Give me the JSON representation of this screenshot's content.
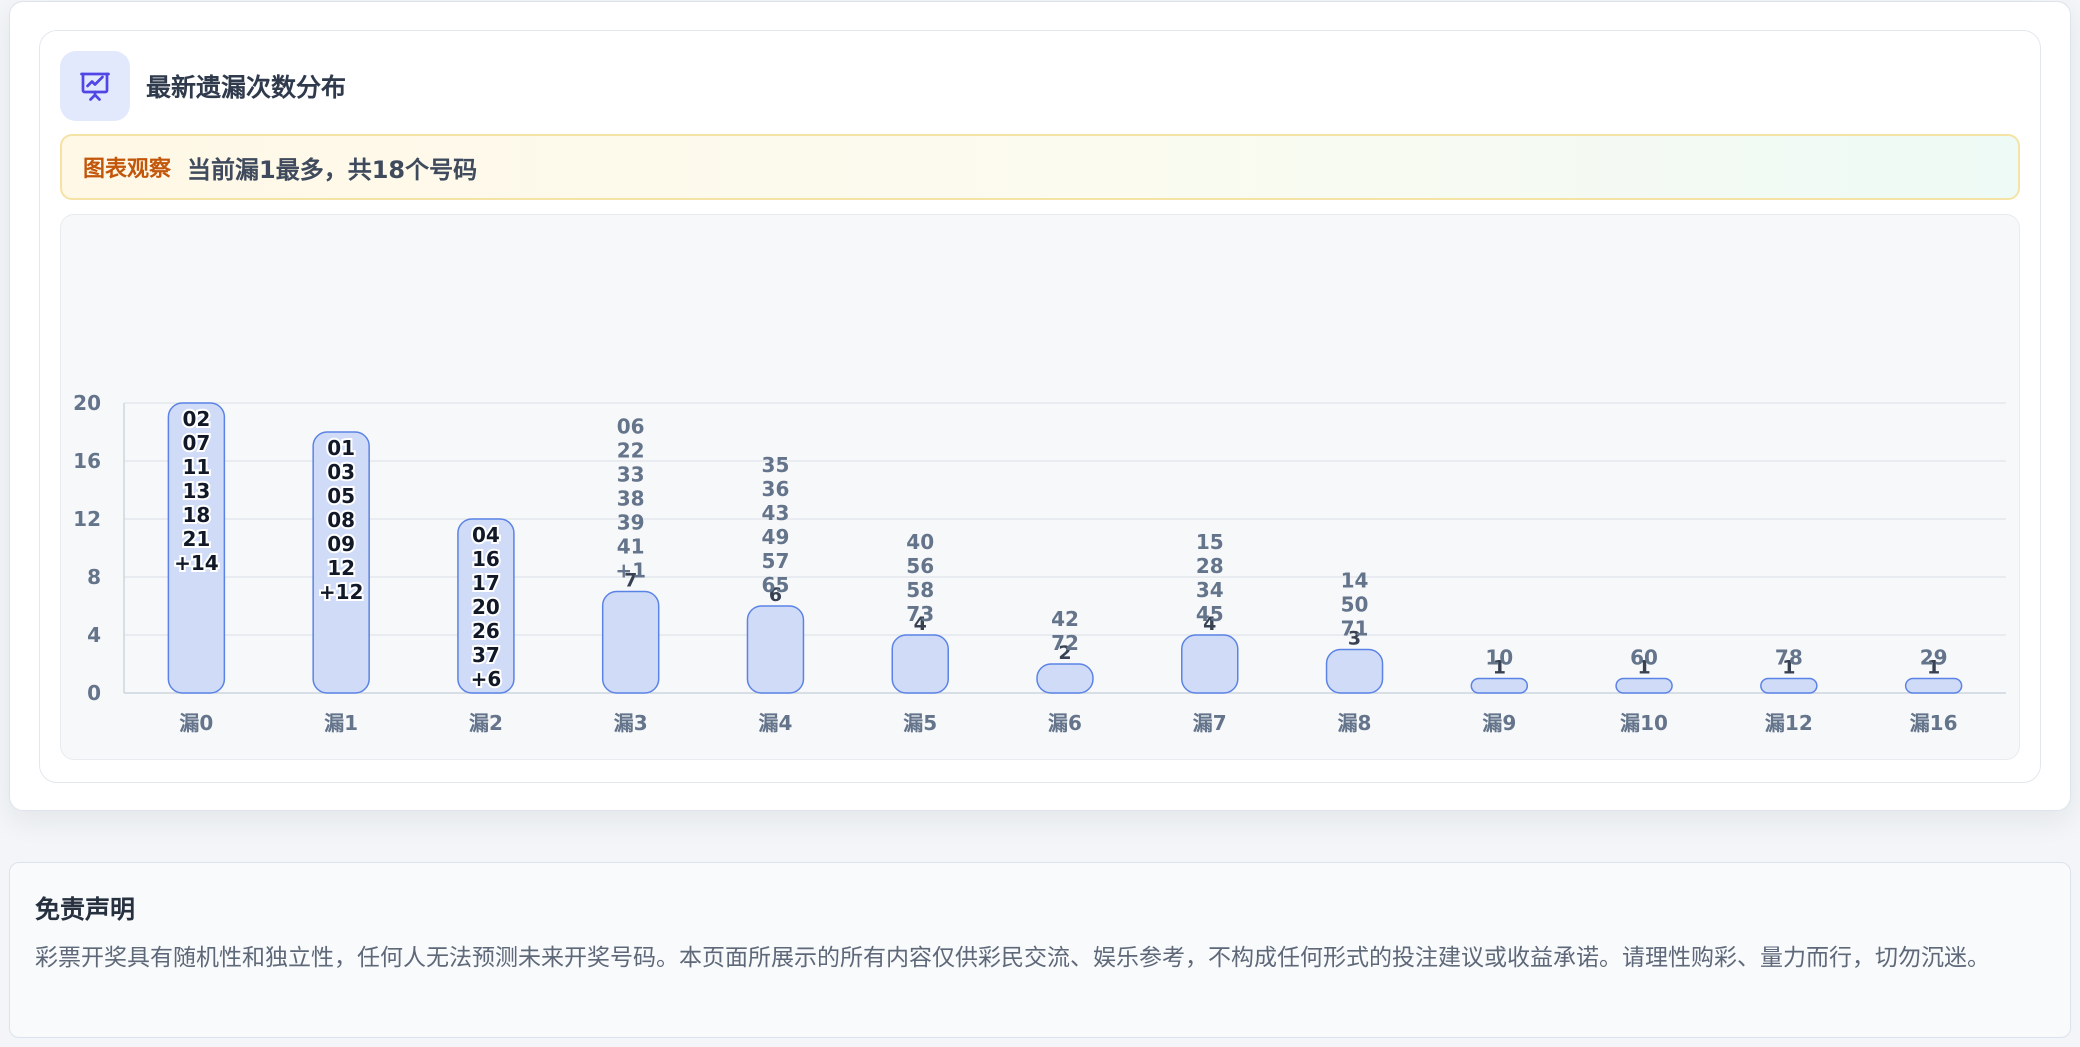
{
  "chart_card": {
    "title": "最新遗漏次数分布",
    "icon": "presentation-chart-icon",
    "observation": {
      "tag": "图表观察",
      "text": "当前漏1最多，共18个号码"
    }
  },
  "chart_data": {
    "type": "bar",
    "ylim": [
      0,
      20
    ],
    "yticks": [
      0,
      4,
      8,
      12,
      16,
      20
    ],
    "grid": true,
    "colors": {
      "bar_fill": "#d0dcf7",
      "bar_stroke": "#5b83e6"
    },
    "categories": [
      "漏0",
      "漏1",
      "漏2",
      "漏3",
      "漏4",
      "漏5",
      "漏6",
      "漏7",
      "漏8",
      "漏9",
      "漏10",
      "漏12",
      "漏16"
    ],
    "values": [
      20,
      18,
      12,
      7,
      6,
      4,
      2,
      4,
      3,
      1,
      1,
      1,
      1
    ],
    "numbers": [
      [
        "02",
        "07",
        "11",
        "13",
        "18",
        "21",
        "+14"
      ],
      [
        "01",
        "03",
        "05",
        "08",
        "09",
        "12",
        "+12"
      ],
      [
        "04",
        "16",
        "17",
        "20",
        "26",
        "37",
        "+6"
      ],
      [
        "06",
        "22",
        "33",
        "38",
        "39",
        "41",
        "+1"
      ],
      [
        "35",
        "36",
        "43",
        "49",
        "57",
        "65"
      ],
      [
        "40",
        "56",
        "58",
        "73"
      ],
      [
        "42",
        "72"
      ],
      [
        "15",
        "28",
        "34",
        "45"
      ],
      [
        "14",
        "50",
        "71"
      ],
      [
        "10"
      ],
      [
        "60"
      ],
      [
        "78"
      ],
      [
        "29"
      ]
    ]
  },
  "disclaimer": {
    "title": "免责声明",
    "text": "彩票开奖具有随机性和独立性，任何人无法预测未来开奖号码。本页面所展示的所有内容仅供彩民交流、娱乐参考，不构成任何形式的投注建议或收益承诺。请理性购彩、量力而行，切勿沉迷。"
  }
}
